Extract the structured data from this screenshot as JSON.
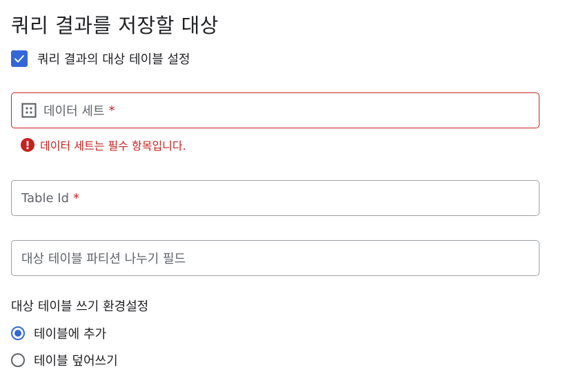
{
  "title": "쿼리 결과를 저장할 대상",
  "destination_checkbox": {
    "label": "쿼리 결과의 대상 테이블 설정",
    "checked": true
  },
  "dataset_field": {
    "placeholder": "데이터 세트",
    "required_marker": "*",
    "icon": "dataset-icon",
    "error_message": "데이터 세트는 필수 항목입니다."
  },
  "table_id_field": {
    "placeholder": "Table Id",
    "required_marker": "*"
  },
  "partition_field": {
    "placeholder": "대상 테이블 파티션 나누기 필드"
  },
  "write_preference": {
    "label": "대상 테이블 쓰기 환경설정",
    "options": [
      {
        "label": "테이블에 추가",
        "selected": true
      },
      {
        "label": "테이블 덮어쓰기",
        "selected": false
      }
    ]
  },
  "colors": {
    "accent": "#3367d6",
    "error": "#c5221f",
    "text": "#202124",
    "secondary_text": "#5f6368",
    "border": "#9aa0a6"
  }
}
